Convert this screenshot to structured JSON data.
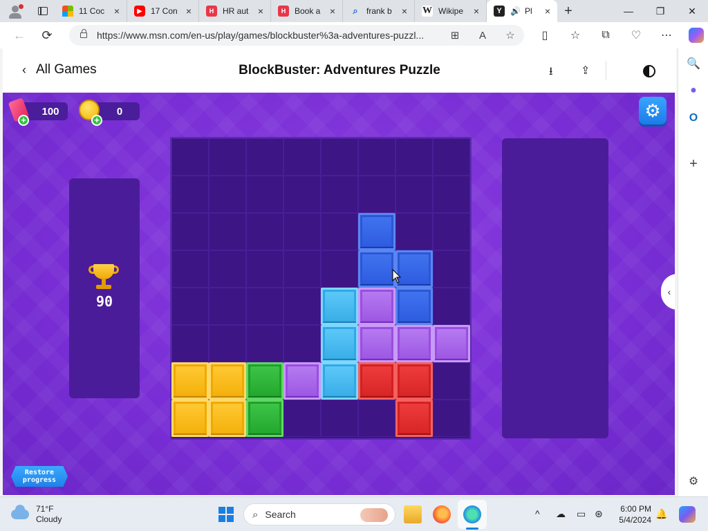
{
  "browser": {
    "tabs": [
      {
        "title": "11 Coc",
        "favicon": "microsoft-icon"
      },
      {
        "title": "17 Con",
        "favicon": "youtube-icon"
      },
      {
        "title": "HR aut",
        "favicon": "hr-icon"
      },
      {
        "title": "Book a",
        "favicon": "hr-icon"
      },
      {
        "title": "frank b",
        "favicon": "search-icon"
      },
      {
        "title": "Wikipe",
        "favicon": "wikipedia-icon"
      },
      {
        "title": "Pl",
        "favicon": "yj-icon",
        "active": true
      }
    ],
    "favicon_letters": {
      "hr": "H",
      "wiki": "W",
      "yj": "Y"
    },
    "url": "https://www.msn.com/en-us/play/games/blockbuster%3a-adventures-puzzl...",
    "icons": {
      "back": "←",
      "refresh": "⟳",
      "apps": "⊞",
      "read_aloud": "A",
      "favorite": "☆",
      "split": "▯",
      "favorites": "☆",
      "collections": "⧉",
      "health": "♡",
      "more": "⋯",
      "new_tab": "+",
      "minimize": "—",
      "restore": "❐",
      "close": "✕",
      "tab_close": "×",
      "audio": "🔊"
    }
  },
  "game_header": {
    "back_label": "All Games",
    "back_chevron": "‹",
    "title": "BlockBuster: Adventures Puzzle",
    "download_icon": "⭳",
    "share_icon": "⇪"
  },
  "game": {
    "gems": "100",
    "coins": "0",
    "best_score": "90",
    "restore_label_line1": "Restore",
    "restore_label_line2": "progress",
    "plus": "+",
    "gear_icon": "⚙",
    "sidetab_icon": "‹",
    "board": {
      "cols": 8,
      "rows": 8,
      "blocks": [
        {
          "row": 2,
          "col": 5,
          "color": "blue"
        },
        {
          "row": 3,
          "col": 5,
          "color": "blue"
        },
        {
          "row": 3,
          "col": 6,
          "color": "blue"
        },
        {
          "row": 4,
          "col": 4,
          "color": "cyan"
        },
        {
          "row": 4,
          "col": 5,
          "color": "purple"
        },
        {
          "row": 4,
          "col": 6,
          "color": "blue"
        },
        {
          "row": 5,
          "col": 4,
          "color": "cyan"
        },
        {
          "row": 5,
          "col": 5,
          "color": "purple"
        },
        {
          "row": 5,
          "col": 6,
          "color": "purple"
        },
        {
          "row": 5,
          "col": 7,
          "color": "purple"
        },
        {
          "row": 6,
          "col": 0,
          "color": "yellow"
        },
        {
          "row": 6,
          "col": 1,
          "color": "yellow"
        },
        {
          "row": 6,
          "col": 2,
          "color": "green"
        },
        {
          "row": 6,
          "col": 3,
          "color": "purple"
        },
        {
          "row": 6,
          "col": 4,
          "color": "cyan"
        },
        {
          "row": 6,
          "col": 5,
          "color": "red"
        },
        {
          "row": 6,
          "col": 6,
          "color": "red"
        },
        {
          "row": 7,
          "col": 0,
          "color": "yellow"
        },
        {
          "row": 7,
          "col": 1,
          "color": "yellow"
        },
        {
          "row": 7,
          "col": 2,
          "color": "green"
        },
        {
          "row": 7,
          "col": 6,
          "color": "red"
        }
      ]
    }
  },
  "edge_sidebar": {
    "search": "🔍",
    "copilot": "●",
    "outlook": "O",
    "add": "+",
    "settings": "⚙"
  },
  "taskbar": {
    "temperature": "71°F",
    "condition": "Cloudy",
    "search_placeholder": "Search",
    "search_icon": "⌕",
    "time": "6:00 PM",
    "date": "5/4/2024",
    "tray": {
      "chevron": "^",
      "cloud_off": "☁",
      "display": "▭",
      "network": "⊛",
      "bell": "🔔"
    }
  }
}
